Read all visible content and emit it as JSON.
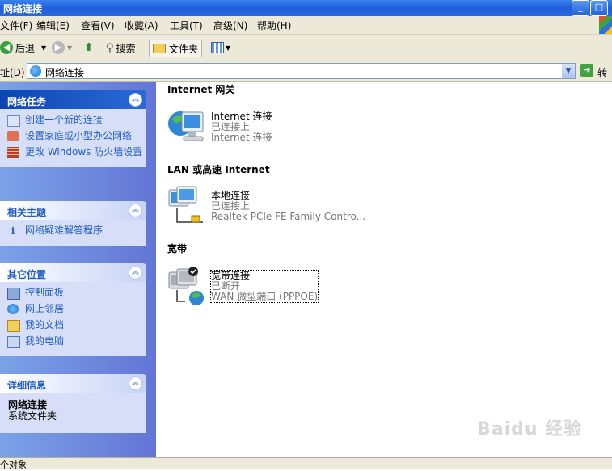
{
  "window": {
    "title": "网络连接"
  },
  "menu": [
    "文件(F)",
    "编辑(E)",
    "查看(V)",
    "收藏(A)",
    "工具(T)",
    "高级(N)",
    "帮助(H)"
  ],
  "toolbar": {
    "back": "后退",
    "search": "搜索",
    "folders": "文件夹"
  },
  "address": {
    "label": "址(D)",
    "value": "网络连接",
    "go": "转到"
  },
  "left": {
    "network_tasks": {
      "title": "网络任务",
      "items": [
        "创建一个新的连接",
        "设置家庭或小型办公网络",
        "更改 Windows 防火墙设置"
      ]
    },
    "related": {
      "title": "相关主题",
      "items": [
        "网络疑难解答程序"
      ]
    },
    "other": {
      "title": "其它位置",
      "items": [
        "控制面板",
        "网上邻居",
        "我的文档",
        "我的电脑"
      ]
    },
    "details": {
      "title": "详细信息",
      "name": "网络连接",
      "type": "系统文件夹"
    }
  },
  "groups": [
    {
      "header": "Internet 网关",
      "name": "Internet 连接",
      "status": "已连接上",
      "device": "Internet 连接"
    },
    {
      "header": "LAN 或高速 Internet",
      "name": "本地连接",
      "status": "已连接上",
      "device": "Realtek PCIe FE Family Contro..."
    },
    {
      "header": "宽带",
      "name": "宽带连接",
      "status": "已断开",
      "device": "WAN 微型端口 (PPPOE)"
    }
  ],
  "status": {
    "text": "个对象"
  },
  "watermark": "Baidu 经验",
  "colors": {
    "taskpane_bg": "#6375d6",
    "link": "#215dc6",
    "titlebar": "#2a6ae0"
  }
}
